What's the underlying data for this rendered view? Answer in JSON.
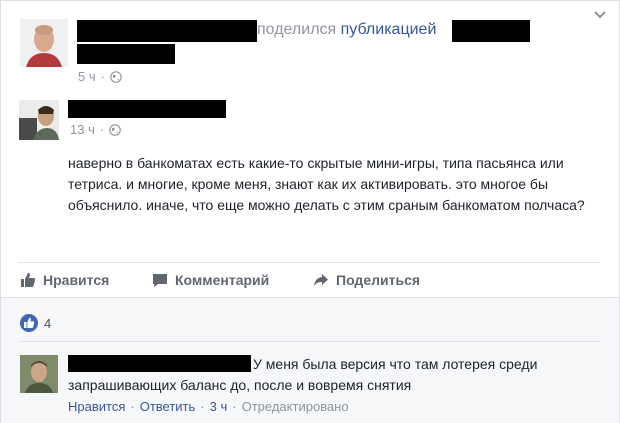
{
  "header": {
    "shared_prefix": "поделился",
    "shared_object": "публикацией",
    "time": "5 ч"
  },
  "post": {
    "time": "13 ч",
    "text": "наверно в банкоматах есть какие-то скрытые мини-игры, типа пасьянса или тетриса. и многие, кроме меня, знают как их активировать. это многое бы объяснило. иначе, что еще можно делать с этим сраным банкоматом полчаса?"
  },
  "actions": {
    "like": "Нравится",
    "comment": "Комментарий",
    "share": "Поделиться"
  },
  "reactions": {
    "count": "4"
  },
  "comment": {
    "text": "У меня была версия что там лотерея среди запрашивающих баланс до, после и вовремя снятия",
    "like": "Нравится",
    "reply": "Ответить",
    "time": "3 ч",
    "edited": "Отредактировано"
  },
  "colors": {
    "link": "#365899",
    "muted": "#90949c",
    "action": "#606770",
    "like_blue": "#4267b2"
  }
}
